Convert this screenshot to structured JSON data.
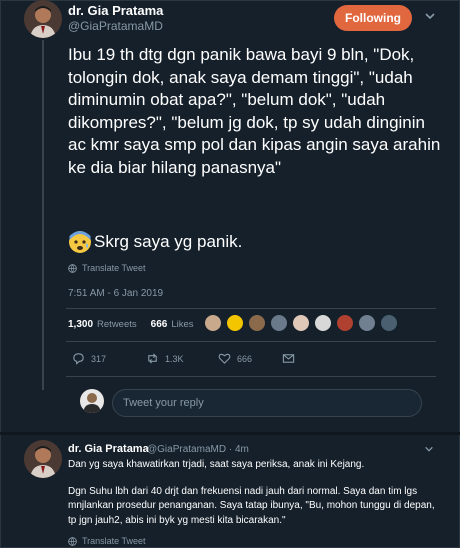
{
  "author": {
    "name": "dr. Gia Pratama",
    "handle": "@GiaPratamaMD",
    "follow_label": "Following"
  },
  "tweet": {
    "text": "Ibu 19 th dtg dgn panik bawa bayi 9 bln, \"Dok, tolongin dok, anak saya demam tinggi\", \"udah diminumin obat apa?\", \"belum dok\", \"udah dikompres?\", \"belum jg dok, tp sy udah dinginin ac kmr saya smp pol dan kipas angin saya arahin ke dia biar hilang panasnya\"",
    "panic_text": "Skrg saya yg panik.",
    "emoji_icon": "anxious-face-with-sweat-emoji",
    "translate_label": "Translate Tweet",
    "timestamp": "7:51 AM - 6 Jan 2019",
    "retweet_count": "1,300",
    "retweet_label": "Retweets",
    "like_count": "666",
    "like_label": "Likes"
  },
  "actions": {
    "reply_count": "317",
    "retweet_count": "1.3K",
    "like_count": "666"
  },
  "likers": [
    "#c9a98c",
    "#f2c500",
    "#8a6a4a",
    "#6b7a8a",
    "#e0c8b8",
    "#d8d8d8",
    "#b04030",
    "#708090",
    "#4a6070"
  ],
  "reply_box": {
    "placeholder": "Tweet your reply"
  },
  "reply_tweet": {
    "name": "dr. Gia Pratama",
    "meta": "@GiaPratamaMD · 4m",
    "paragraphs": [
      "Dan yg saya khawatirkan trjadi, saat saya periksa, anak ini Kejang.",
      "Dgn Suhu lbh dari 40 drjt dan frekuensi nadi jauh dari normal. Saya dan tim lgs mnjlankan prosedur penanganan. Saya tatap ibunya, \"Bu, mohon tunggu di depan, tp jgn jauh2, abis ini byk yg mesti kita bicarakan.\""
    ],
    "translate_label": "Translate Tweet"
  },
  "colors": {
    "background": "#15202b",
    "follow_button": "#e0673e",
    "muted_text": "#8899a6",
    "divider": "#38444d"
  }
}
